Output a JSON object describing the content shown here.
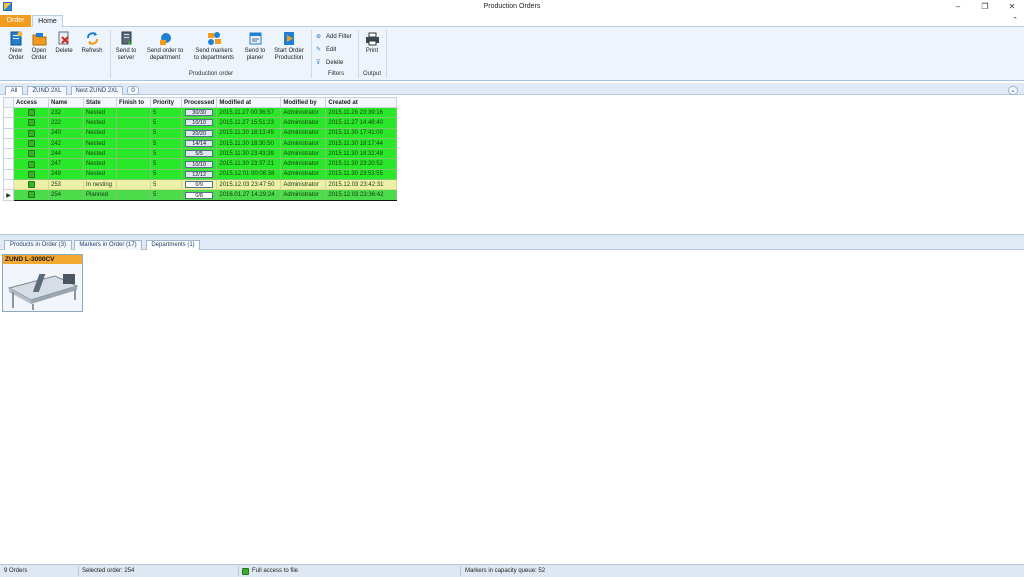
{
  "window": {
    "title": "Production Orders",
    "controls": {
      "minimize": "–",
      "maximize": "❐",
      "close": "✕"
    }
  },
  "ribbon_tabs": {
    "file_tab": "Order",
    "home_tab": "Home",
    "collapse_glyph": "⌃"
  },
  "ribbon": {
    "order_group": {
      "new_order": [
        "New",
        "Order"
      ],
      "open_order": [
        "Open",
        "Order"
      ],
      "delete": "Delete",
      "refresh": "Refresh"
    },
    "production_group": {
      "label": "Production order",
      "send_to_server": [
        "Send to",
        "server"
      ],
      "send_order_to_department": [
        "Send order to",
        "department"
      ],
      "send_markers_to_departments": [
        "Send markers",
        "to departments"
      ],
      "send_to_planer": [
        "Send to",
        "planer"
      ],
      "start_order_production": [
        "Start Order",
        "Production"
      ]
    },
    "filters_group": {
      "label": "Filters",
      "add_filter": "Add Filter",
      "edit": "Edit",
      "delete": "Delete"
    },
    "output_group": {
      "label": "Output",
      "print": "Print"
    }
  },
  "filter_tabs": {
    "all": "All",
    "zund_2xl": "ZUND 2XL",
    "nest_zund_2xl": "Nest ZUND 2XL",
    "count_badge": "0",
    "options_glyph": "⌄"
  },
  "orders_table": {
    "columns": [
      "Access",
      "Name",
      "State",
      "Finish to",
      "Priority",
      "Processed",
      "Modified at",
      "Modified by",
      "Created at"
    ],
    "rows": [
      {
        "name": "232",
        "state": "Nested",
        "finish_to": "",
        "priority": "5",
        "processed": "30/30",
        "modified_at": "2015.11.27 00:36:57",
        "modified_by": "Administrator",
        "created_at": "2015.11.26 23:39:16",
        "style": "nested"
      },
      {
        "name": "222",
        "state": "Nested",
        "finish_to": "",
        "priority": "5",
        "processed": "10/10",
        "modified_at": "2015.11.27 15:51:23",
        "modified_by": "Administrator",
        "created_at": "2015.11.27 14:48:40",
        "style": "nested"
      },
      {
        "name": "240",
        "state": "Nested",
        "finish_to": "",
        "priority": "5",
        "processed": "20/20",
        "modified_at": "2015.11.30 18:13:45",
        "modified_by": "Administrator",
        "created_at": "2015.11.30 17:41:00",
        "style": "nested"
      },
      {
        "name": "242",
        "state": "Nested",
        "finish_to": "",
        "priority": "5",
        "processed": "14/14",
        "modified_at": "2015.11.30 18:30:50",
        "modified_by": "Administrator",
        "created_at": "2015.11.30 18:17:44",
        "style": "nested"
      },
      {
        "name": "244",
        "state": "Nested",
        "finish_to": "",
        "priority": "5",
        "processed": "5/5",
        "modified_at": "2015.11.30 23:43:39",
        "modified_by": "Administrator",
        "created_at": "2015.11.30 18:32:48",
        "style": "nested"
      },
      {
        "name": "247",
        "state": "Nested",
        "finish_to": "",
        "priority": "5",
        "processed": "10/10",
        "modified_at": "2015.11.30 23:37:21",
        "modified_by": "Administrator",
        "created_at": "2015.11.30 23:20:52",
        "style": "nested"
      },
      {
        "name": "249",
        "state": "Nested",
        "finish_to": "",
        "priority": "5",
        "processed": "12/12",
        "modified_at": "2015.12.01 00:06:38",
        "modified_by": "Administrator",
        "created_at": "2015.11.30 23:53:55",
        "style": "nested"
      },
      {
        "name": "253",
        "state": "In nesting",
        "finish_to": "",
        "priority": "5",
        "processed": "0/9",
        "modified_at": "2015.12.03 23:47:50",
        "modified_by": "Administrator",
        "created_at": "2015.12.03 23:42:31",
        "style": "nesting"
      },
      {
        "name": "254",
        "state": "Planned",
        "finish_to": "",
        "priority": "5",
        "processed": "0/8",
        "modified_at": "2016.01.27 14:29:24",
        "modified_by": "Administrator",
        "created_at": "2015.12.03 23:36:42",
        "style": "planned",
        "selected": true
      }
    ],
    "row_indicator_glyph": "▶"
  },
  "detail_tabs": {
    "products": "Products in Order (3)",
    "markers": "Markers in Order (17)",
    "departments": "Departments (1)"
  },
  "department_card": {
    "title": "ZUND L-3000CV"
  },
  "status_bar": {
    "orders_count": "9 Orders",
    "selected_order": "Selected order: 254",
    "access": "Full access to file",
    "markers_queue": "Markers in capacity queue: 52"
  },
  "colors": {
    "nested": "#29e829",
    "nesting": "#eff0a8",
    "planned": "#4bdb4b",
    "file_tab": "#f29b1d",
    "dept_header": "#f3a82f"
  }
}
